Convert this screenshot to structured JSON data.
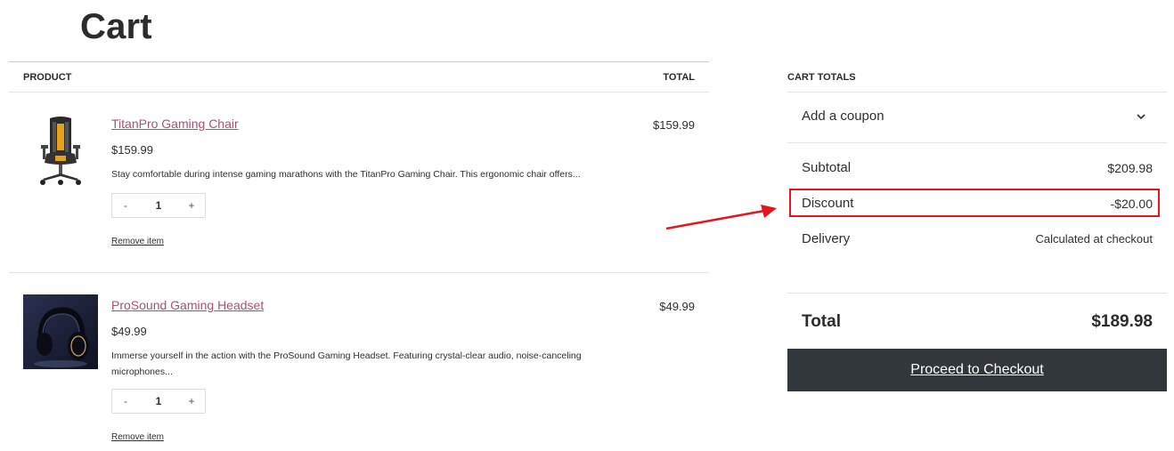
{
  "page": {
    "title": "Cart"
  },
  "table": {
    "product_header": "PRODUCT",
    "total_header": "TOTAL"
  },
  "items": [
    {
      "name": "TitanPro Gaming Chair",
      "price": "$159.99",
      "description": "Stay comfortable during intense gaming marathons with the TitanPro Gaming Chair. This ergonomic chair offers...",
      "quantity": "1",
      "line_total": "$159.99",
      "remove_label": "Remove item",
      "image_icon": "gaming-chair-image"
    },
    {
      "name": "ProSound Gaming Headset",
      "price": "$49.99",
      "description": "Immerse yourself in the action with the ProSound Gaming Headset. Featuring crystal-clear audio, noise-canceling microphones...",
      "quantity": "1",
      "line_total": "$49.99",
      "remove_label": "Remove item",
      "image_icon": "headset-image"
    }
  ],
  "qty": {
    "minus": "-",
    "plus": "+"
  },
  "totals": {
    "title": "CART TOTALS",
    "coupon_label": "Add a coupon",
    "subtotal_label": "Subtotal",
    "subtotal_value": "$209.98",
    "discount_label": "Discount",
    "discount_value": "-$20.00",
    "delivery_label": "Delivery",
    "delivery_value": "Calculated at checkout",
    "total_label": "Total",
    "total_value": "$189.98",
    "checkout_label": "Proceed to Checkout"
  },
  "colors": {
    "link": "#b24c75",
    "checkout_bg": "#32373c",
    "highlight": "#e4161d"
  }
}
